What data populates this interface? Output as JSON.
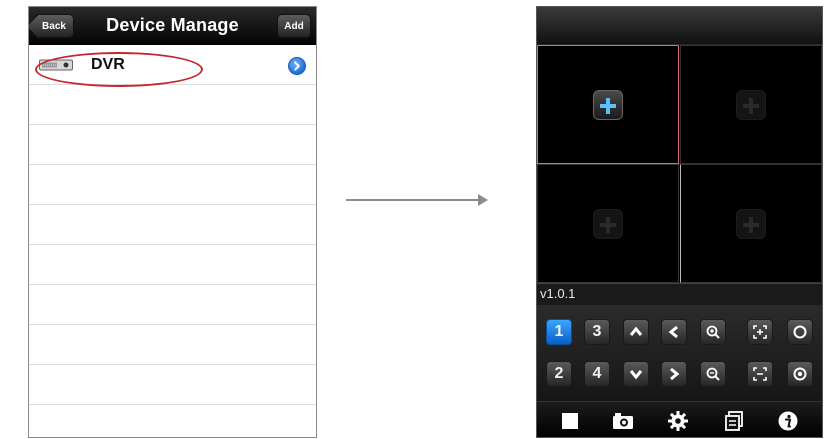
{
  "left_screen": {
    "back_label": "Back",
    "title": "Device Manage",
    "add_label": "Add",
    "devices": [
      {
        "name": "DVR",
        "icon": "dvr-device-icon",
        "accessory": "blue-disclosure-icon"
      }
    ],
    "empty_row_count": 9
  },
  "right_screen": {
    "version": "v1.0.1",
    "video_grid": {
      "cells": [
        {
          "selected": true,
          "icon": "add-channel-icon"
        },
        {
          "selected": false,
          "icon": "add-channel-icon"
        },
        {
          "selected": false,
          "icon": "add-channel-icon"
        },
        {
          "selected": false,
          "icon": "add-channel-icon"
        }
      ]
    },
    "controls": {
      "row1": [
        {
          "label": "1",
          "selected": true
        },
        {
          "label": "3"
        },
        {
          "icon": "arrow-up-icon"
        },
        {
          "icon": "arrow-left-icon"
        },
        {
          "icon": "zoom-in-icon"
        },
        {
          "icon": "focus-in-icon"
        },
        {
          "icon": "iris-open-icon"
        }
      ],
      "row2": [
        {
          "label": "2"
        },
        {
          "label": "4"
        },
        {
          "icon": "arrow-down-icon"
        },
        {
          "icon": "arrow-right-icon"
        },
        {
          "icon": "zoom-out-icon"
        },
        {
          "icon": "focus-out-icon"
        },
        {
          "icon": "iris-close-icon"
        }
      ]
    },
    "toolbar": [
      "stop-icon",
      "snapshot-icon",
      "settings-icon",
      "gallery-icon",
      "info-icon"
    ]
  },
  "colors": {
    "selection_highlight": "#c4282e",
    "accent_blue": "#1f6ed6",
    "plus_blue": "#5cc0ff",
    "selected_cell_border": "#d86d74"
  }
}
